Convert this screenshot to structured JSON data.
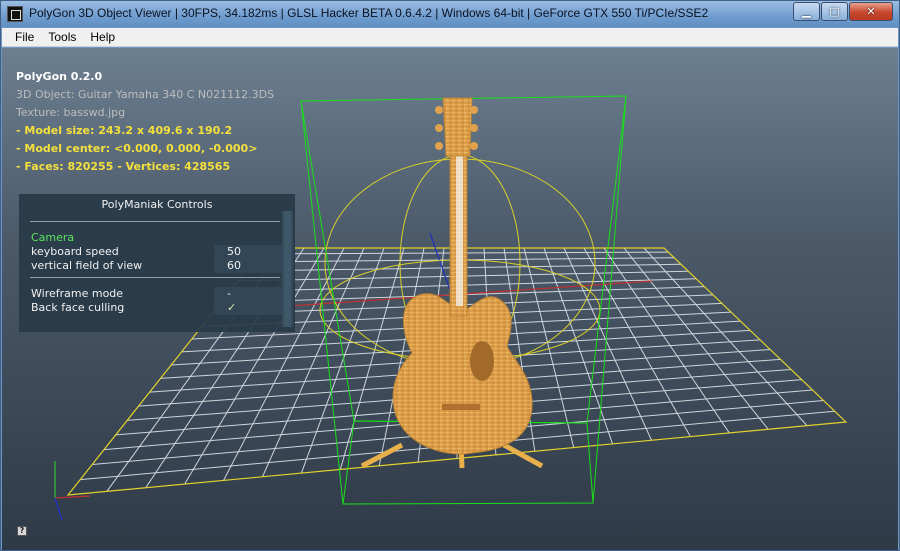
{
  "window": {
    "title": "PolyGon 3D Object Viewer | 30FPS, 34.182ms | GLSL Hacker BETA 0.6.4.2 | Windows 64-bit | GeForce GTX 550 Ti/PCIe/SSE2"
  },
  "menu": [
    "File",
    "Tools",
    "Help"
  ],
  "hud": {
    "app_version": "PolyGon 0.2.0",
    "object": "3D Object: Guitar Yamaha 340 C N021112.3DS",
    "texture": "Texture: basswd.jpg",
    "model_size": "- Model size:  243.2 x 409.6 x 190.2",
    "model_center": "- Model center:  <0.000, 0.000, -0.000>",
    "faces_vertices": "- Faces: 820255 - Vertices: 428565"
  },
  "controls": {
    "title": "PolyManiak Controls",
    "camera_header": "Camera",
    "keyboard_speed_label": "keyboard speed",
    "keyboard_speed_value": "50",
    "fov_label": "vertical field of view",
    "fov_value": "60",
    "wireframe_label": "Wireframe mode",
    "wireframe_value": "-",
    "backface_label": "Back face culling",
    "backface_value": "✓"
  },
  "help_button": "?",
  "colors": {
    "hud_yellow": "#f4e03c",
    "camera_green": "#5de35d",
    "bbox_green": "#19e019",
    "sphere_yellow": "#d8d02a",
    "wood": "#e2a24c"
  }
}
